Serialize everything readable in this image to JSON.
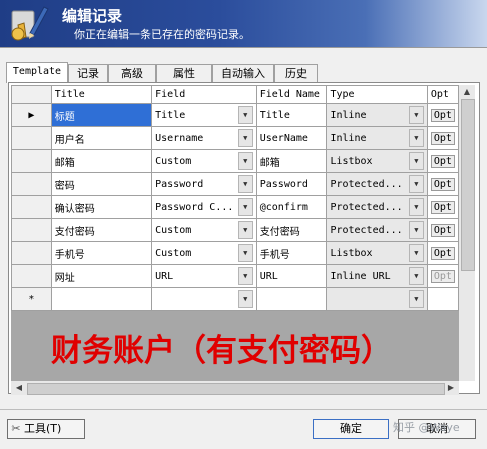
{
  "header": {
    "title": "编辑记录",
    "subtitle": "你正在编辑一条已存在的密码记录。"
  },
  "tabs": [
    "Template",
    "记录",
    "高级",
    "属性",
    "自动输入",
    "历史"
  ],
  "columns": [
    "Title",
    "Field",
    "Field Name",
    "Type",
    "Opt"
  ],
  "rows": [
    {
      "title": "标题",
      "field": "Title",
      "fieldname": "Title",
      "type": "Inline",
      "opt": "Opt"
    },
    {
      "title": "用户名",
      "field": "Username",
      "fieldname": "UserName",
      "type": "Inline",
      "opt": "Opt"
    },
    {
      "title": "邮箱",
      "field": "Custom",
      "fieldname": "邮箱",
      "type": "Listbox",
      "opt": "Opt"
    },
    {
      "title": "密码",
      "field": "Password",
      "fieldname": "Password",
      "type": "Protected...",
      "opt": "Opt"
    },
    {
      "title": "确认密码",
      "field": "Password C...",
      "fieldname": "@confirm",
      "type": "Protected...",
      "opt": "Opt"
    },
    {
      "title": "支付密码",
      "field": "Custom",
      "fieldname": "支付密码",
      "type": "Protected...",
      "opt": "Opt"
    },
    {
      "title": "手机号",
      "field": "Custom",
      "fieldname": "手机号",
      "type": "Listbox",
      "opt": "Opt"
    },
    {
      "title": "网址",
      "field": "URL",
      "fieldname": "URL",
      "type": "Inline URL",
      "opt": "Opt"
    }
  ],
  "new_row_marker": "*",
  "current_row_marker": "▶",
  "overlay_text": "财务账户（有支付密码）",
  "buttons": {
    "tools": "工具(T)",
    "ok": "确定",
    "cancel": "取消"
  },
  "watermark": "知乎 @Waye"
}
